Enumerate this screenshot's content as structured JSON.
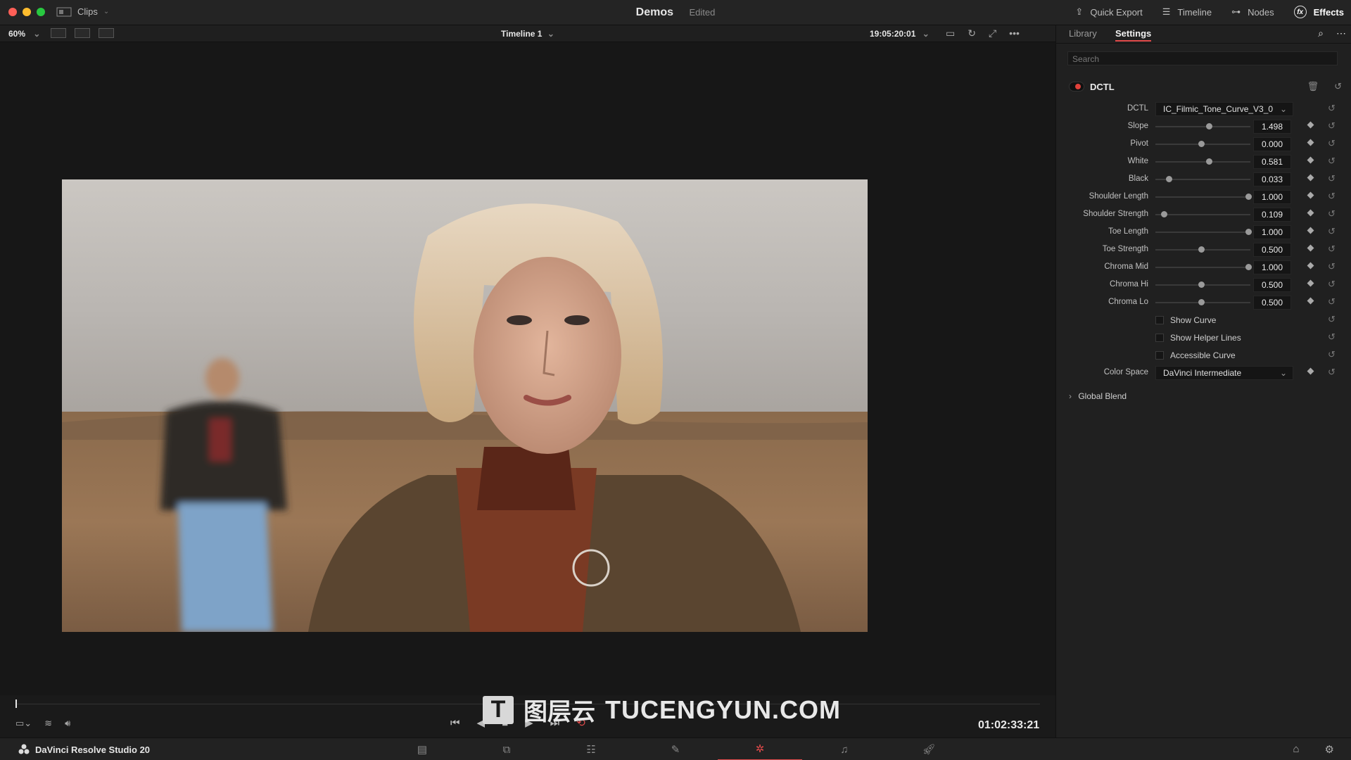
{
  "titlebar": {
    "clips_label": "Clips",
    "project_name": "Demos",
    "project_status": "Edited",
    "actions": [
      "Quick Export",
      "Timeline",
      "Nodes",
      "Effects"
    ]
  },
  "viewer_header": {
    "zoom": "60%",
    "timeline_name": "Timeline 1",
    "timecode": "19:05:20:01"
  },
  "transport": {
    "timecode": "01:02:33:21"
  },
  "bottombar": {
    "app_name": "DaVinci Resolve Studio 20"
  },
  "inspector": {
    "tabs": [
      "Library",
      "Settings"
    ],
    "active_tab": "Settings",
    "search_placeholder": "Search",
    "effect_name": "DCTL",
    "dctl_label": "DCTL",
    "dctl_value": "IC_Filmic_Tone_Curve_V3_0",
    "params": [
      {
        "label": "Slope",
        "value": "1.498",
        "pos": 0.56
      },
      {
        "label": "Pivot",
        "value": "0.000",
        "pos": 0.48
      },
      {
        "label": "White",
        "value": "0.581",
        "pos": 0.56
      },
      {
        "label": "Black",
        "value": "0.033",
        "pos": 0.14
      },
      {
        "label": "Shoulder Length",
        "value": "1.000",
        "pos": 0.98
      },
      {
        "label": "Shoulder Strength",
        "value": "0.109",
        "pos": 0.09
      },
      {
        "label": "Toe Length",
        "value": "1.000",
        "pos": 0.98
      },
      {
        "label": "Toe Strength",
        "value": "0.500",
        "pos": 0.48
      },
      {
        "label": "Chroma Mid",
        "value": "1.000",
        "pos": 0.98
      },
      {
        "label": "Chroma Hi",
        "value": "0.500",
        "pos": 0.48
      },
      {
        "label": "Chroma Lo",
        "value": "0.500",
        "pos": 0.48
      }
    ],
    "checkboxes": [
      "Show Curve",
      "Show Helper Lines",
      "Accessible Curve"
    ],
    "color_space_label": "Color Space",
    "color_space_value": "DaVinci Intermediate",
    "global_blend": "Global Blend"
  },
  "watermark": {
    "mark": "T",
    "cn": "图层云",
    "en": "TUCENGYUN.COM"
  },
  "colors": {
    "accent": "#e04a4a",
    "panel": "#202020"
  }
}
